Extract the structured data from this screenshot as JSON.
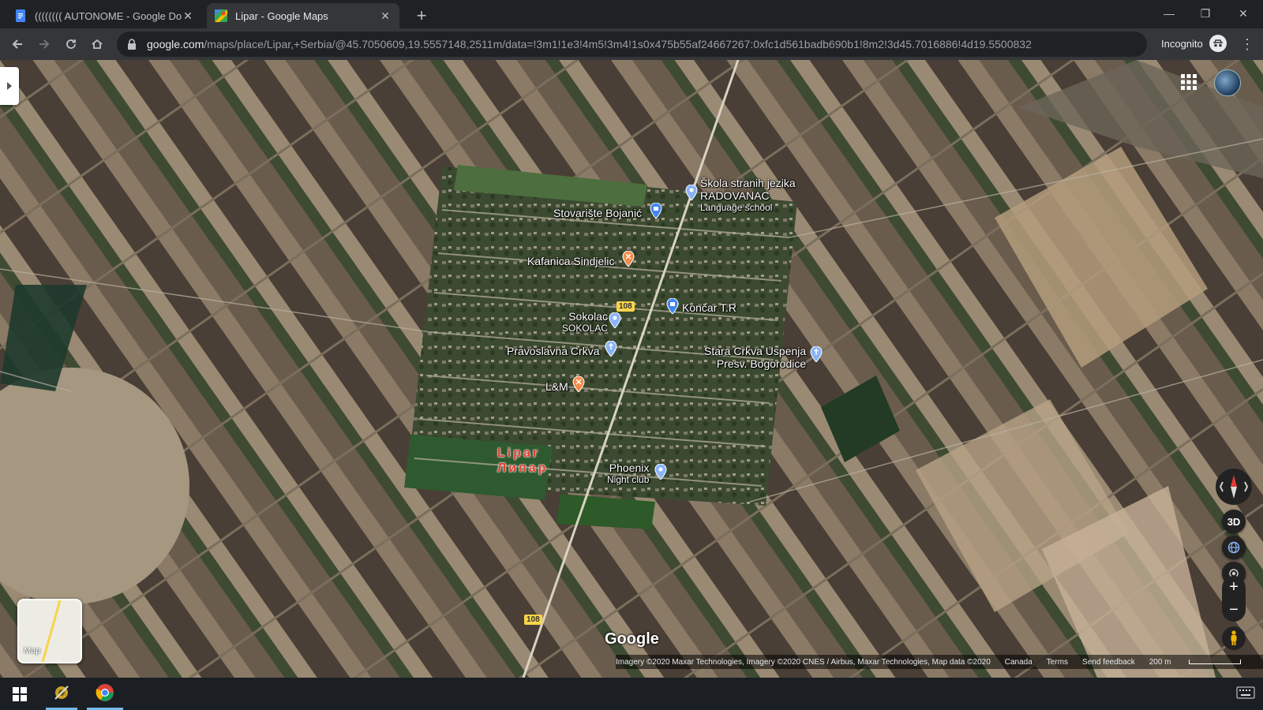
{
  "browser": {
    "tabs": [
      {
        "title": "(((((((( AUTONOME - Google Do",
        "icon": "google-docs-icon",
        "active": false
      },
      {
        "title": "Lipar - Google Maps",
        "icon": "google-maps-icon",
        "active": true
      }
    ],
    "new_tab_symbol": "+",
    "url_host": "google.com",
    "url_path": "/maps/place/Lipar,+Serbia/@45.7050609,19.5557148,2511m/data=!3m1!1e3!4m5!3m4!1s0x475b55af24667267:0xfc1d561badb690b1!8m2!3d45.7016886!4d19.5500832",
    "incognito_label": "Incognito"
  },
  "map": {
    "town_label_latin": "Lipar",
    "town_label_cyrillic": "Липар",
    "road_number": "108",
    "places": [
      {
        "name": "Škola stranih jezika",
        "line2": "RADOVANAC",
        "sub": "Language school",
        "pin_color": "#8ab4f8"
      },
      {
        "name": "Stovarište Bojanić",
        "pin_color": "#4285f4"
      },
      {
        "name": "Kafanica Sindjelic",
        "pin_color": "#f28b49"
      },
      {
        "name": "Končar T.R",
        "pin_color": "#4285f4"
      },
      {
        "name": "Sokolac",
        "sub": "SOKOLAC",
        "pin_color": "#8ab4f8"
      },
      {
        "name": "Pravoslavna Crkva",
        "pin_color": "#8ab4f8"
      },
      {
        "name": "Stara Crkva Uspenja",
        "line2": "Presv. Bogorodice",
        "pin_color": "#8ab4f8"
      },
      {
        "name": "L&M",
        "pin_color": "#f28b49"
      },
      {
        "name": "Phoenix",
        "sub": "Night club",
        "pin_color": "#8ab4f8"
      }
    ],
    "minimap_label": "Map",
    "tilt_label": "3D",
    "zoom_in": "+",
    "zoom_out": "−",
    "logo": "Google",
    "footer": {
      "attribution": "Imagery ©2020 Maxar Technologies, Imagery ©2020 CNES / Airbus, Maxar Technologies, Map data ©2020",
      "region": "Canada",
      "terms": "Terms",
      "feedback": "Send feedback",
      "scale": "200 m"
    }
  }
}
